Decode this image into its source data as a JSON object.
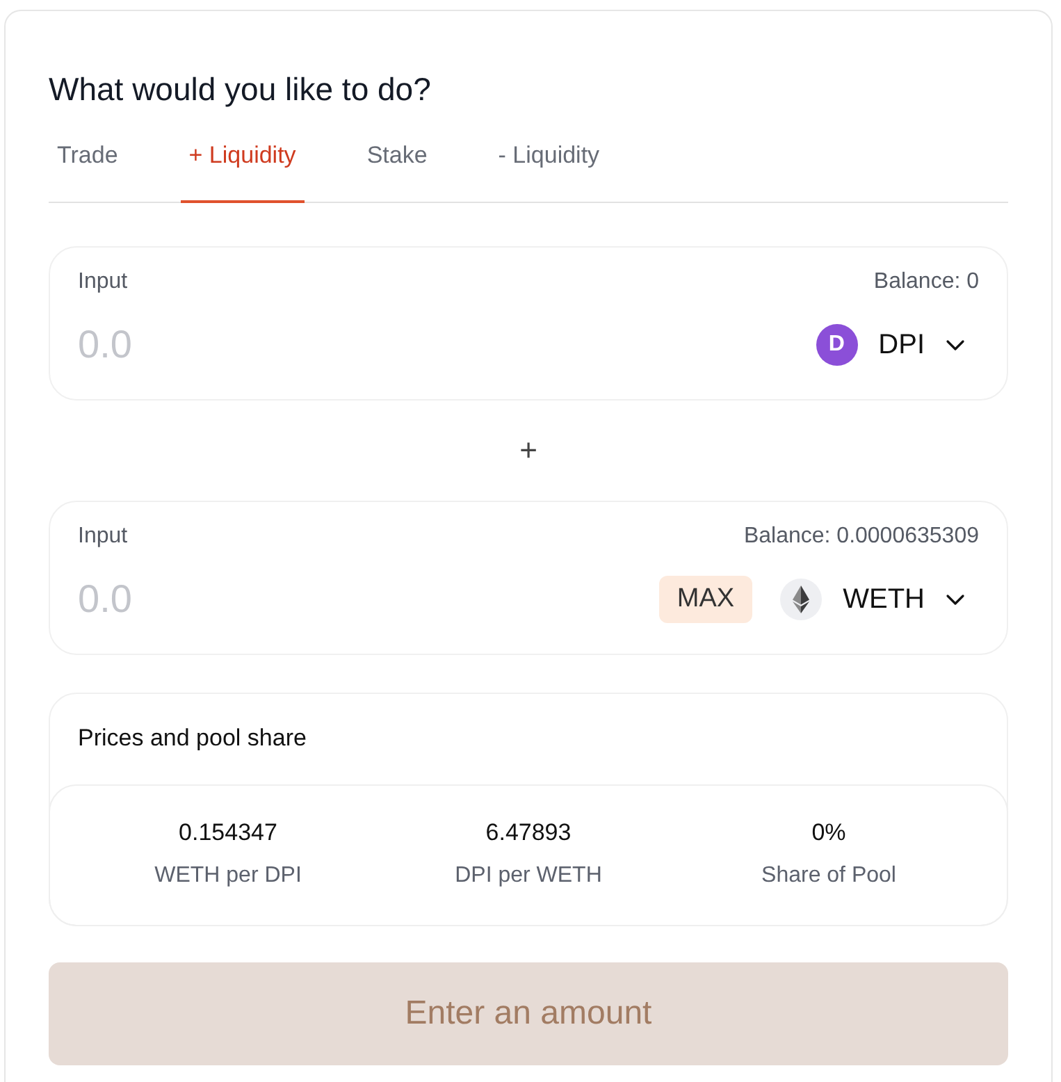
{
  "heading": "What would you like to do?",
  "tabs": [
    {
      "label": "Trade",
      "selected": false
    },
    {
      "label": "+ Liquidity",
      "selected": true
    },
    {
      "label": "Stake",
      "selected": false
    },
    {
      "label": "- Liquidity",
      "selected": false
    }
  ],
  "inputs": [
    {
      "label": "Input",
      "balance": "Balance: 0",
      "placeholder": "0.0",
      "token": {
        "symbol": "DPI",
        "kind": "letter",
        "logo_letter": "D"
      }
    },
    {
      "label": "Input",
      "balance": "Balance: 0.0000635309",
      "placeholder": "0.0",
      "max_button": "MAX",
      "token": {
        "symbol": "WETH",
        "kind": "diamond"
      }
    }
  ],
  "separator": "+",
  "prices": {
    "title": "Prices and pool share",
    "stats": [
      {
        "value": "0.154347",
        "label": "WETH per DPI"
      },
      {
        "value": "6.47893",
        "label": "DPI per WETH"
      },
      {
        "value": "0%",
        "label": "Share of Pool"
      }
    ]
  },
  "submit": {
    "label": "Enter an amount",
    "disabled": true
  }
}
